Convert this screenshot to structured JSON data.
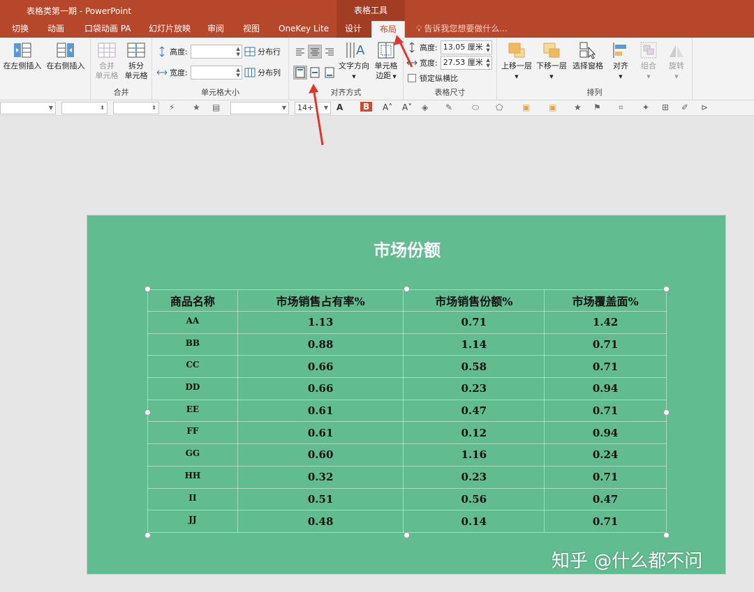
{
  "window": {
    "title": "表格类第一期 - PowerPoint",
    "context_group": "表格工具"
  },
  "tabs": [
    {
      "label": "切换"
    },
    {
      "label": "动画"
    },
    {
      "label": "口袋动画 PA"
    },
    {
      "label": "幻灯片放映"
    },
    {
      "label": "审阅"
    },
    {
      "label": "视图"
    },
    {
      "label": "OneKey Lite"
    },
    {
      "label": "设计"
    },
    {
      "label": "布局",
      "active": true
    }
  ],
  "tell_me": "告诉我您想要做什么...",
  "ribbon": {
    "rows_cols": {
      "insert_left": "在左侧插入",
      "insert_right": "在右侧插入"
    },
    "merge": {
      "label": "合并",
      "merge_cells": [
        "合并",
        "单元格"
      ],
      "split_cells": [
        "拆分",
        "单元格"
      ]
    },
    "cell_size": {
      "label": "单元格大小",
      "height_label": "高度:",
      "width_label": "宽度:",
      "height_value": "",
      "width_value": "",
      "distribute_rows": "分布行",
      "distribute_cols": "分布列"
    },
    "alignment": {
      "label": "对齐方式",
      "text_direction": "文字方向",
      "cell_margins": [
        "单元格",
        "边距"
      ],
      "selected_vertical": "center"
    },
    "table_size": {
      "label": "表格尺寸",
      "height_label": "高度:",
      "width_label": "宽度:",
      "height_value": "13.05 厘米",
      "width_value": "27.53 厘米",
      "lock_ratio": "锁定纵横比",
      "lock_ratio_checked": false
    },
    "arrange": {
      "label": "排列",
      "bring_forward": "上移一层",
      "send_backward": "下移一层",
      "selection_pane": "选择窗格",
      "align": "对齐",
      "group": "组合",
      "rotate": "旋转"
    }
  },
  "mini_toolbar": {
    "font_size": "14+"
  },
  "slide": {
    "title": "市场份额",
    "table": {
      "headers": [
        "商品名称",
        "市场销售占有率%",
        "市场销售份额%",
        "市场覆盖面%"
      ],
      "rows": [
        [
          "AA",
          "1.13",
          "0.71",
          "1.42"
        ],
        [
          "BB",
          "0.88",
          "1.14",
          "0.71"
        ],
        [
          "CC",
          "0.66",
          "0.58",
          "0.71"
        ],
        [
          "DD",
          "0.66",
          "0.23",
          "0.94"
        ],
        [
          "EE",
          "0.61",
          "0.47",
          "0.71"
        ],
        [
          "FF",
          "0.61",
          "0.12",
          "0.94"
        ],
        [
          "GG",
          "0.60",
          "1.16",
          "0.24"
        ],
        [
          "HH",
          "0.32",
          "0.23",
          "0.71"
        ],
        [
          "II",
          "0.51",
          "0.56",
          "0.47"
        ],
        [
          "JJ",
          "0.48",
          "0.14",
          "0.71"
        ]
      ]
    },
    "background_color": "#61bc90"
  },
  "watermark": "知乎 @什么都不问",
  "colors": {
    "accent": "#b7472a",
    "annotation_arrow": "#e8332a"
  }
}
